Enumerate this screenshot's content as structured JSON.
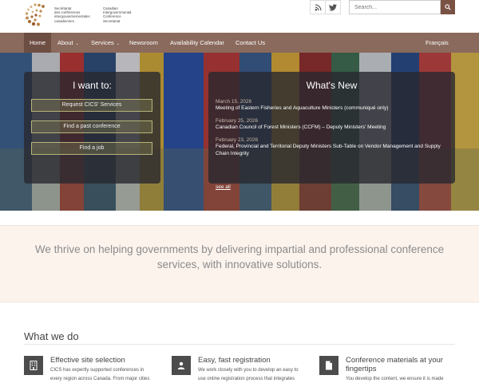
{
  "logo": {
    "french_lines": [
      "Secrétariat",
      "des conférences",
      "intergouvernementales",
      "canadiennes"
    ],
    "english_lines": [
      "Canadian",
      "Intergovernmental",
      "Conference",
      "Secretariat"
    ]
  },
  "header": {
    "rss_icon": "rss-icon",
    "twitter_icon": "twitter-icon",
    "search_placeholder": "Search...",
    "search_icon": "search-icon"
  },
  "nav": {
    "items": [
      {
        "label": "Home",
        "active": true
      },
      {
        "label": "About",
        "caret": "⌄"
      },
      {
        "label": "Services",
        "caret": "⌄"
      },
      {
        "label": "Newsroom"
      },
      {
        "label": "Availability Calendar"
      },
      {
        "label": "Contact Us"
      }
    ],
    "language": "Français"
  },
  "want": {
    "title": "I want to:",
    "buttons": [
      "Request CICS' Services",
      "Find a past conference",
      "Find a job"
    ]
  },
  "news": {
    "title": "What's New",
    "items": [
      {
        "date": "March 15, 2026",
        "title": "Meeting of Eastern Fisheries and Aquaculture Ministers (communiqué only)"
      },
      {
        "date": "February 25, 2026",
        "title": "Canadian Council of Forest Ministers (CCFM) – Deputy Ministers' Meeting"
      },
      {
        "date": "February 23, 2026",
        "title": "Federal, Provincial and Territorial Deputy Ministers Sub-Table on Vendor Management and Supply Chain Integrity"
      }
    ],
    "see_all": "see all"
  },
  "tagline": "We thrive on helping governments by delivering impartial and professional conference services, with innovative solutions.",
  "what_we_do": {
    "title": "What we do",
    "features": [
      {
        "title": "Effective site selection",
        "text": "CICS has expertly supported conferences in every region across Canada. From major cities to",
        "icon": "building-icon"
      },
      {
        "title": "Easy, fast registration",
        "text": "We work closely with you to develop an easy to use online registration process that integrates",
        "icon": "user-icon"
      },
      {
        "title": "Conference materials at your fingertips",
        "text": "You develop the content, we ensure it is made",
        "icon": "document-icon"
      }
    ]
  },
  "colors": {
    "nav_bg": "#8a6a5c",
    "nav_active": "#6d4e42",
    "brand_accent": "#7a5244",
    "tagline_bg": "#fcf3ed"
  }
}
